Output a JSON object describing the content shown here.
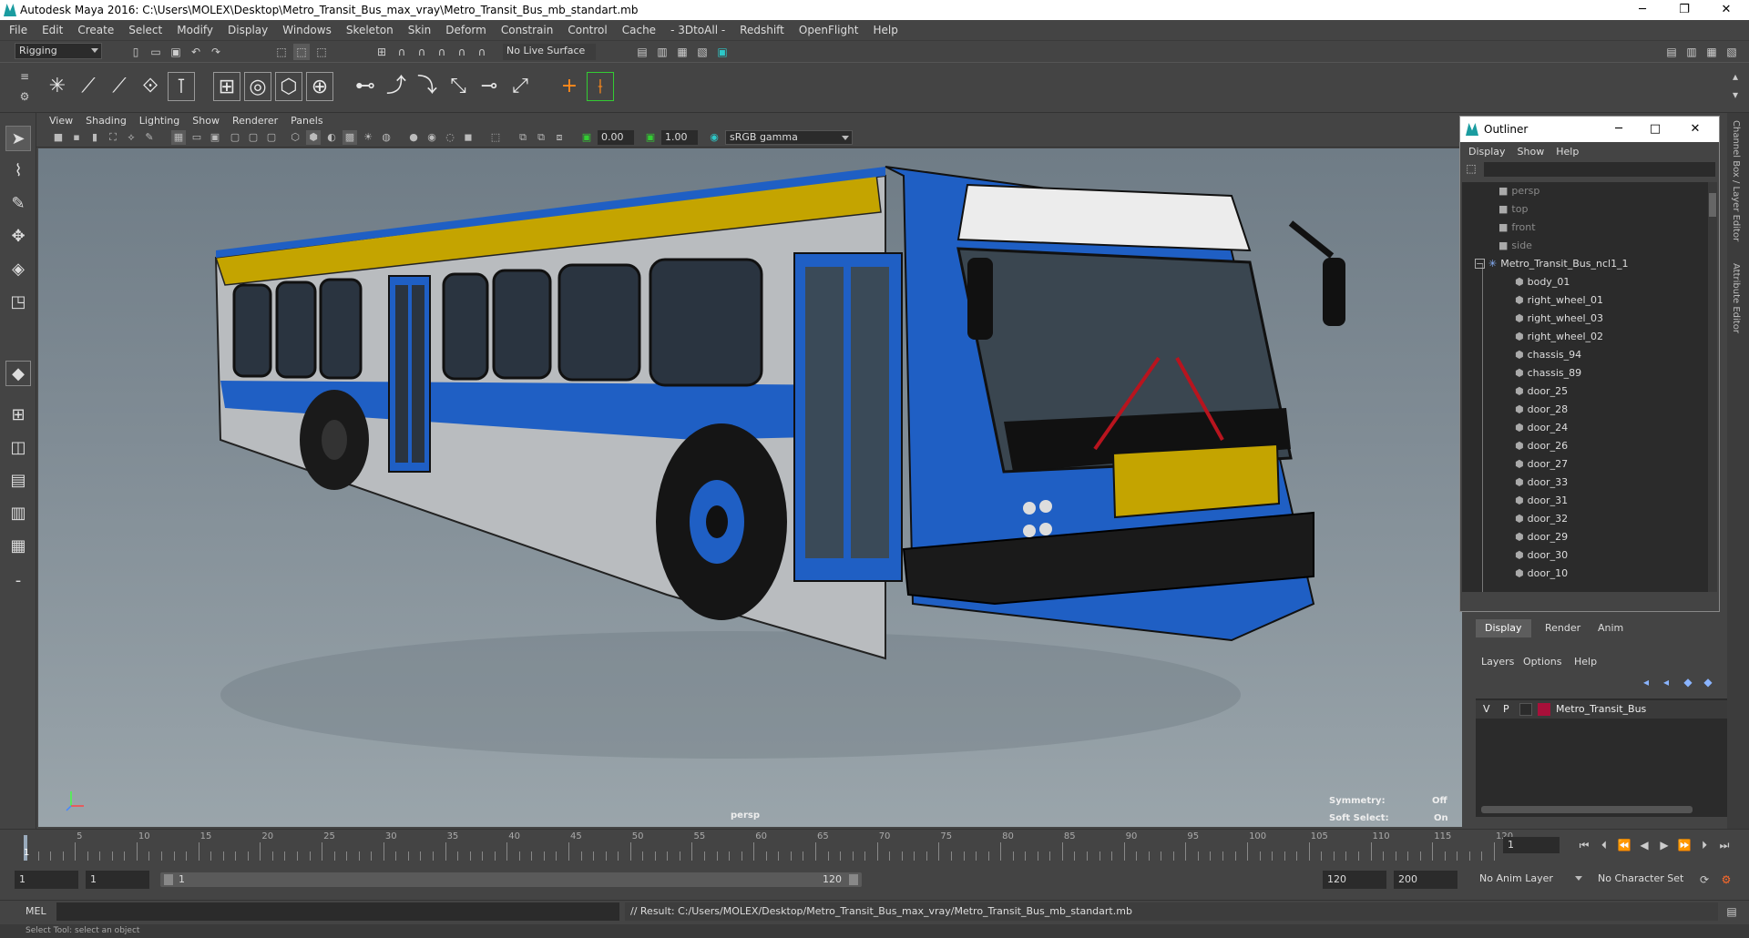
{
  "window": {
    "title": "Autodesk Maya 2016: C:\\Users\\MOLEX\\Desktop\\Metro_Transit_Bus_max_vray\\Metro_Transit_Bus_mb_standart.mb",
    "minimize": "─",
    "maximize": "❐",
    "close": "✕"
  },
  "menubar": [
    "File",
    "Edit",
    "Create",
    "Select",
    "Modify",
    "Display",
    "Windows",
    "Skeleton",
    "Skin",
    "Deform",
    "Constrain",
    "Control",
    "Cache",
    "- 3DtoAll -",
    "Redshift",
    "OpenFlight",
    "Help"
  ],
  "statusline": {
    "mode": "Rigging",
    "live_surface": "No Live Surface"
  },
  "viewport": {
    "menu": [
      "View",
      "Shading",
      "Lighting",
      "Show",
      "Renderer",
      "Panels"
    ],
    "exposure": "0.00",
    "gamma": "1.00",
    "color_space": "sRGB gamma",
    "camera_label": "persp",
    "symmetry_label": "Symmetry:",
    "symmetry_value": "Off",
    "soft_select_label": "Soft Select:",
    "soft_select_value": "On",
    "colors": {
      "bus_blue": "#1f5fc4",
      "bus_yellow": "#c4a400",
      "bus_gray": "#b8bcc0"
    }
  },
  "outliner": {
    "title": "Outliner",
    "menu": [
      "Display",
      "Show",
      "Help"
    ],
    "cameras": [
      "persp",
      "top",
      "front",
      "side"
    ],
    "root": "Metro_Transit_Bus_ncl1_1",
    "children": [
      "body_01",
      "right_wheel_01",
      "right_wheel_03",
      "right_wheel_02",
      "chassis_94",
      "chassis_89",
      "door_25",
      "door_28",
      "door_24",
      "door_26",
      "door_27",
      "door_33",
      "door_31",
      "door_32",
      "door_29",
      "door_30",
      "door_10"
    ]
  },
  "channel_box": {
    "tabs": [
      "Display",
      "Render",
      "Anim"
    ],
    "menu": [
      "Layers",
      "Options",
      "Help"
    ],
    "layer": {
      "v": "V",
      "p": "P",
      "name": "Metro_Transit_Bus",
      "color": "#a8103a"
    }
  },
  "side_strip": {
    "channel_box_label": "Channel Box / Layer Editor",
    "attribute_editor_label": "Attribute Editor"
  },
  "timeline": {
    "current_frame": "1",
    "labels": [
      "5",
      "10",
      "15",
      "20",
      "25",
      "30",
      "35",
      "40",
      "45",
      "50",
      "55",
      "60",
      "65",
      "70",
      "75",
      "80",
      "85",
      "90",
      "95",
      "100",
      "105",
      "110",
      "115",
      "120"
    ],
    "frame_field": "1"
  },
  "range": {
    "start": "1",
    "playback_start": "1",
    "slider_start": "1",
    "slider_end": "120",
    "playback_end": "120",
    "end": "200",
    "anim_layer": "No Anim Layer",
    "character_set": "No Character Set"
  },
  "command": {
    "lang": "MEL",
    "result": "// Result: C:/Users/MOLEX/Desktop/Metro_Transit_Bus_max_vray/Metro_Transit_Bus_mb_standart.mb"
  },
  "help_line": "Select Tool: select an object"
}
